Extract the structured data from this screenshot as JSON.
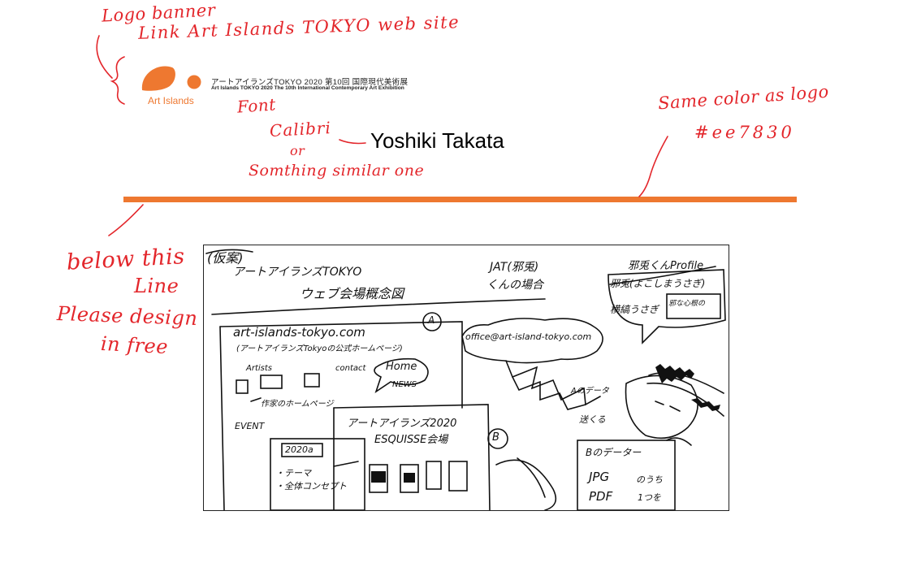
{
  "annotations": {
    "logo_banner": "Logo banner",
    "link_site": "Link Art Islands TOKYO web site",
    "font": "Font",
    "calibri": "Calibri",
    "or": "or",
    "something_similar": "Somthing similar one",
    "same_color": "Same color as logo",
    "hex": "#ee7830",
    "below_this": "below this",
    "line": "Line",
    "please_design": "Please design",
    "in_free": "in free"
  },
  "logo": {
    "wordmark": "Art Islands",
    "title_jp": "アートアイランズTOKYO 2020 第10回 国際現代美術展",
    "title_en": "Art Islands TOKYO 2020 The 10th International Contemporary Art Exhibition"
  },
  "artist_name": "Yoshiki Takata",
  "colors": {
    "accent": "#ee7830",
    "annotation": "#e3262b"
  },
  "sketch": {
    "draft": "(仮案)",
    "title1": "アートアイランズTOKYO",
    "title2": "ウェブ会場概念図",
    "jat1": "JAT(邪兎)",
    "jat2": "くんの場合",
    "profile": "邪兎くんProfile",
    "profile_line1": "邪兎(よこしまうさぎ)",
    "profile_line2": "横縞うさぎ",
    "profile_line3": "邪な心根の",
    "url": "art-islands-tokyo.com",
    "url_sub": "(アートアイランズTokyoの公式ホームページ)",
    "marker_a": "A",
    "marker_b": "B",
    "email": "office@art-island-tokyo.com",
    "artists": "Artists",
    "contact": "contact",
    "home": "Home",
    "news": "NEWS",
    "artist_pages": "作家のホームページ",
    "event": "EVENT",
    "esquisse1": "アートアイランズ2020",
    "esquisse2": "ESQUISSE会場",
    "year": "2020a",
    "theme": "・テーマ",
    "concept": "・全体コンセプト",
    "data_a": "Aのデータ",
    "send": "送くる",
    "data_b": "Bのデーター",
    "jpg": "JPG",
    "pdf": "PDF",
    "of": "のうち",
    "one": "1つを"
  }
}
